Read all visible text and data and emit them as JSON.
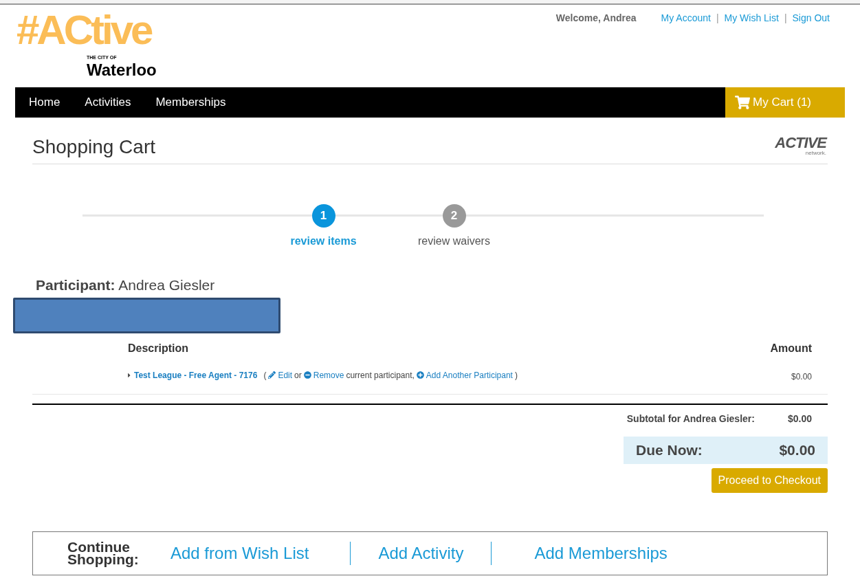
{
  "logo": {
    "hashtag": "#ACtive",
    "city_of": "THE CITY OF",
    "city": "Waterloo"
  },
  "header": {
    "welcome": "Welcome, Andrea",
    "links": [
      "My Account",
      "My Wish List",
      "Sign Out"
    ],
    "separator": "|"
  },
  "nav": {
    "items": [
      "Home",
      "Activities",
      "Memberships"
    ],
    "cart": "My Cart (1)"
  },
  "page_title": "Shopping Cart",
  "partner_logo": {
    "name": "ACTIVE",
    "sub": "network."
  },
  "steps": [
    {
      "number": "1",
      "label": "review items",
      "selected": true
    },
    {
      "number": "2",
      "label": "review waivers",
      "selected": false
    }
  ],
  "participant": {
    "label": "Participant:",
    "name": "Andrea Giesler"
  },
  "table": {
    "columns": [
      "Description",
      "Amount"
    ],
    "rows": [
      {
        "item": "Test League - Free Agent - 7176",
        "open": "(",
        "edit": "Edit",
        "or": "or",
        "remove": "Remove",
        "current": "current participant,",
        "add": "Add Another Participant",
        "close": ")",
        "amount": "$0.00"
      }
    ]
  },
  "subtotal": {
    "label": "Subtotal for Andrea Giesler:",
    "value": "$0.00"
  },
  "due": {
    "label": "Due Now:",
    "value": "$0.00"
  },
  "checkout_button": "Proceed to Checkout",
  "continue": {
    "label": "Continue Shopping:",
    "links": [
      "Add from Wish List",
      "Add Activity",
      "Add Memberships"
    ]
  }
}
